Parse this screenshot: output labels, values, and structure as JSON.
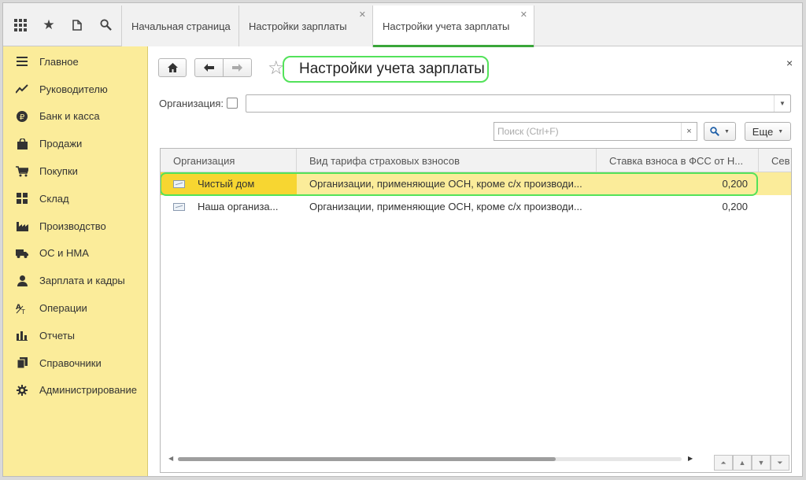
{
  "tabs": [
    {
      "label": "Начальная страница",
      "closable": false,
      "active": false
    },
    {
      "label": "Настройки зарплаты",
      "closable": true,
      "active": false
    },
    {
      "label": "Настройки учета зарплаты",
      "closable": true,
      "active": true
    }
  ],
  "topicons": [
    "apps-grid-icon",
    "favorites-star-icon",
    "history-icon",
    "search-icon"
  ],
  "sidebar": {
    "items": [
      {
        "label": "Главное",
        "icon": "menu-lines-icon"
      },
      {
        "label": "Руководителю",
        "icon": "trend-chart-icon"
      },
      {
        "label": "Банк и касса",
        "icon": "ruble-coin-icon"
      },
      {
        "label": "Продажи",
        "icon": "shopping-bag-icon"
      },
      {
        "label": "Покупки",
        "icon": "shopping-cart-icon"
      },
      {
        "label": "Склад",
        "icon": "warehouse-icon"
      },
      {
        "label": "Производство",
        "icon": "factory-icon"
      },
      {
        "label": "ОС и НМА",
        "icon": "truck-icon"
      },
      {
        "label": "Зарплата и кадры",
        "icon": "person-icon"
      },
      {
        "label": "Операции",
        "icon": "operations-icon"
      },
      {
        "label": "Отчеты",
        "icon": "bar-chart-icon"
      },
      {
        "label": "Справочники",
        "icon": "books-icon"
      },
      {
        "label": "Администрирование",
        "icon": "gear-icon"
      }
    ]
  },
  "form": {
    "title": "Настройки учета зарплаты",
    "org_label": "Организация:",
    "org_value": "",
    "search_placeholder": "Поиск (Ctrl+F)",
    "more_label": "Еще",
    "close_symbol": "×"
  },
  "table": {
    "columns": [
      "Организация",
      "Вид тарифа страховых взносов",
      "Ставка взноса в ФСС от Н...",
      "Сев"
    ],
    "rows": [
      {
        "org": "Чистый дом",
        "tariff": "Организации, применяющие ОСН, кроме с/х производи...",
        "rate": "0,200",
        "selected": true
      },
      {
        "org": "Наша организа...",
        "tariff": "Организации, применяющие ОСН, кроме с/х производи...",
        "rate": "0,200",
        "selected": false
      }
    ]
  },
  "colors": {
    "sidebar_bg": "#fbec9a",
    "selected_row": "#fbec9a",
    "selected_cell": "#f7d631",
    "highlight": "#53e25a",
    "active_tab": "#3aa63a"
  }
}
